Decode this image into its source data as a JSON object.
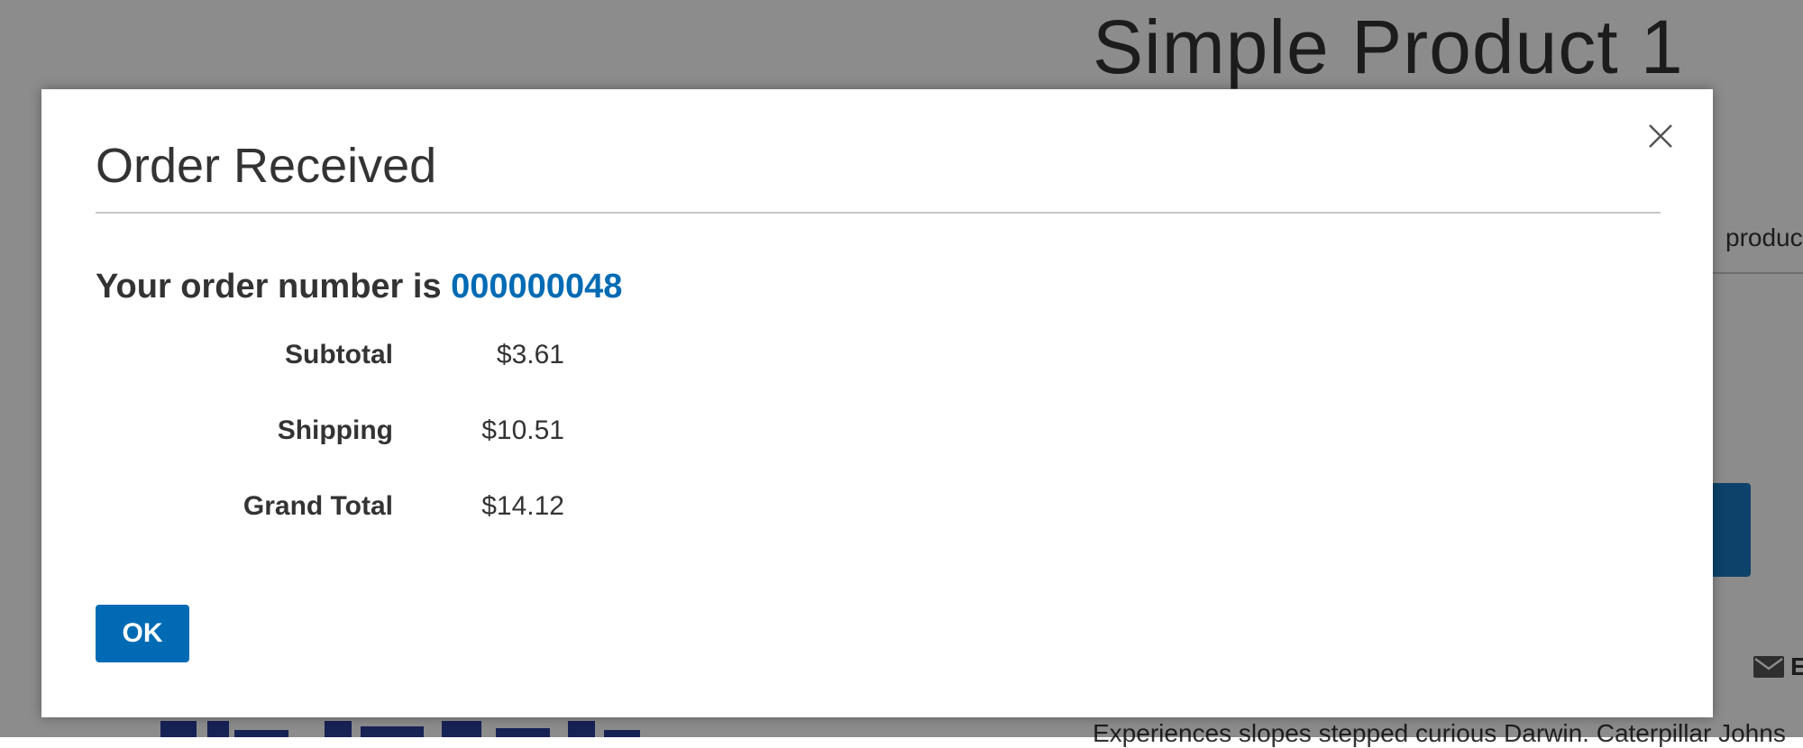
{
  "page": {
    "product_title": "Simple Product 1",
    "tab_label": "produc",
    "email_label": "E",
    "description": "Experiences slopes stepped curious Darwin. Caterpillar Johns"
  },
  "modal": {
    "title": "Order Received",
    "order_prefix": "Your order number is ",
    "order_number": "000000048",
    "totals": [
      {
        "label": "Subtotal",
        "value": "$3.61"
      },
      {
        "label": "Shipping",
        "value": "$10.51"
      },
      {
        "label": "Grand Total",
        "value": "$14.12"
      }
    ],
    "ok_label": "OK"
  },
  "colors": {
    "accent": "#006bb4",
    "text": "#333333",
    "overlay": "rgba(0,0,0,0.45)"
  },
  "icons": {
    "close": "close-icon",
    "email": "envelope-icon"
  }
}
